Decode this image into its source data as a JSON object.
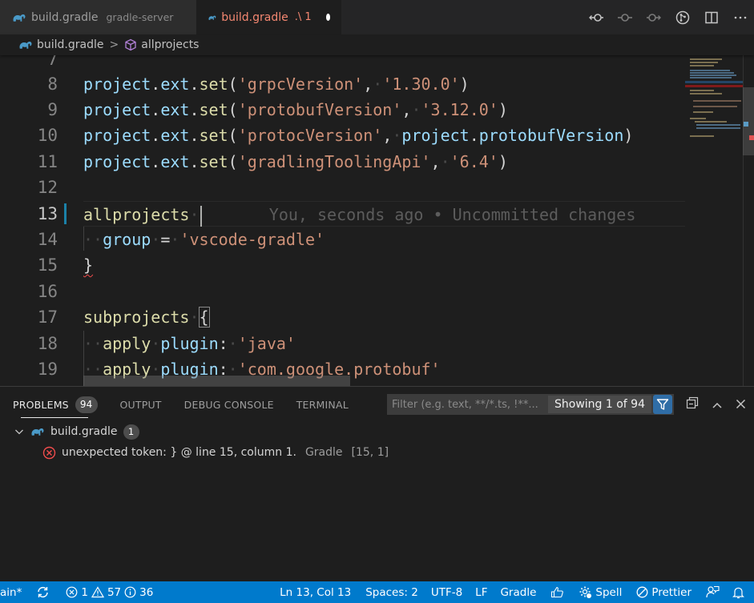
{
  "tabs": [
    {
      "label": "build.gradle",
      "description": "gradle-server",
      "active": false,
      "icon": "gradle-elephant-icon"
    },
    {
      "label": "build.gradle",
      "description": ".\\ 1",
      "active": true,
      "dirty": true,
      "icon": "gradle-elephant-icon"
    }
  ],
  "editor_actions": [
    {
      "name": "git-previous-change-icon",
      "glyph": "⟲"
    },
    {
      "name": "git-change-icon",
      "glyph": "○"
    },
    {
      "name": "git-next-change-icon",
      "glyph": "⟳"
    },
    {
      "name": "git-compare-icon",
      "glyph": "⑂"
    },
    {
      "name": "split-editor-icon",
      "glyph": "◫"
    },
    {
      "name": "more-actions-icon",
      "glyph": "⋯"
    }
  ],
  "breadcrumb": {
    "file": "build.gradle",
    "separator": ">",
    "symbol": "allprojects"
  },
  "editor": {
    "partial_top_line_number": "7",
    "current_line": 13,
    "lines": [
      {
        "n": "8"
      },
      {
        "n": "9"
      },
      {
        "n": "10"
      },
      {
        "n": "11"
      },
      {
        "n": "12"
      },
      {
        "n": "13"
      },
      {
        "n": "14"
      },
      {
        "n": "15"
      },
      {
        "n": "16"
      },
      {
        "n": "17"
      },
      {
        "n": "18"
      },
      {
        "n": "19"
      }
    ],
    "code": {
      "l8": {
        "obj": "project",
        "dot1": ".",
        "prop": "ext",
        "dot2": ".",
        "fn": "set",
        "open": "(",
        "key": "'grpcVersion'",
        "comma": ",",
        "val": "'1.30.0'",
        "close": ")"
      },
      "l9": {
        "obj": "project",
        "dot1": ".",
        "prop": "ext",
        "dot2": ".",
        "fn": "set",
        "open": "(",
        "key": "'protobufVersion'",
        "comma": ",",
        "val": "'3.12.0'",
        "close": ")"
      },
      "l10": {
        "obj": "project",
        "dot1": ".",
        "prop": "ext",
        "dot2": ".",
        "fn": "set",
        "open": "(",
        "key": "'protocVersion'",
        "comma": ",",
        "val_obj": "project",
        "val_dot": ".",
        "val_prop": "protobufVersion",
        "close": ")"
      },
      "l11": {
        "obj": "project",
        "dot1": ".",
        "prop": "ext",
        "dot2": ".",
        "fn": "set",
        "open": "(",
        "key": "'gradlingToolingApi'",
        "comma": ",",
        "val": "'6.4'",
        "close": ")"
      },
      "l13": {
        "kw": "allprojects",
        "blame": "You, seconds ago • Uncommitted changes"
      },
      "l14": {
        "var": "group",
        "eq": "=",
        "val": "'vscode-gradle'"
      },
      "l15": {
        "brace": "}"
      },
      "l17": {
        "kw": "subprojects",
        "brace": "{"
      },
      "l18": {
        "fn": "apply",
        "var": "plugin",
        "colon": ":",
        "val": "'java'"
      },
      "l19": {
        "fn": "apply",
        "var": "plugin",
        "colon": ":",
        "val": "'com.google.protobuf'"
      }
    },
    "whitespace_glyph": "·"
  },
  "panel": {
    "tabs": [
      {
        "label": "PROBLEMS",
        "badge": "94",
        "active": true
      },
      {
        "label": "OUTPUT"
      },
      {
        "label": "DEBUG CONSOLE"
      },
      {
        "label": "TERMINAL"
      }
    ],
    "filter": {
      "placeholder": "Filter (e.g. text, **/*.ts, !**...",
      "value": ""
    },
    "showing": "Showing 1 of 94",
    "problems": [
      {
        "file": "build.gradle",
        "count": "1",
        "items": [
          {
            "severity": "error",
            "message": "unexpected token: } @ line 15, column 1.",
            "source": "Gradle",
            "position": "[15, 1]"
          }
        ]
      }
    ]
  },
  "statusbar": {
    "branch": "ain*",
    "errors": "1",
    "warnings": "57",
    "infos": "36",
    "cursor": "Ln 13, Col 13",
    "indent": "Spaces: 2",
    "encoding": "UTF-8",
    "eol": "LF",
    "language": "Gradle",
    "spell": "Spell",
    "prettier": "Prettier"
  },
  "colors": {
    "accent": "#007acc",
    "tab_modified": "#f48771",
    "error": "#f14c4c",
    "gradle_icon": "#4a9ac8"
  }
}
